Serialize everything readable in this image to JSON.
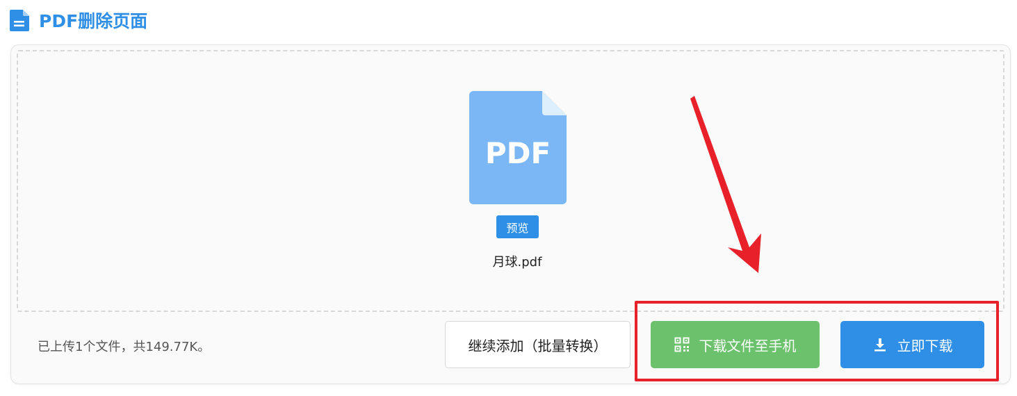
{
  "header": {
    "title": "PDF删除页面",
    "icon": "document-icon"
  },
  "file": {
    "thumbnail_label": "PDF",
    "preview_label": "预览",
    "name": "月球.pdf"
  },
  "footer": {
    "status": "已上传1个文件，共149.77K。",
    "add_more_label": "继续添加（批量转换）",
    "send_phone_label": "下载文件至手机",
    "download_label": "立即下载"
  },
  "colors": {
    "primary_blue": "#2f8fe6",
    "green": "#6cc16c",
    "annotation_red": "#e8202a",
    "pdf_thumb": "#7bb7f5"
  },
  "icons": {
    "send_phone": "qr-code-icon",
    "download": "download-icon"
  }
}
